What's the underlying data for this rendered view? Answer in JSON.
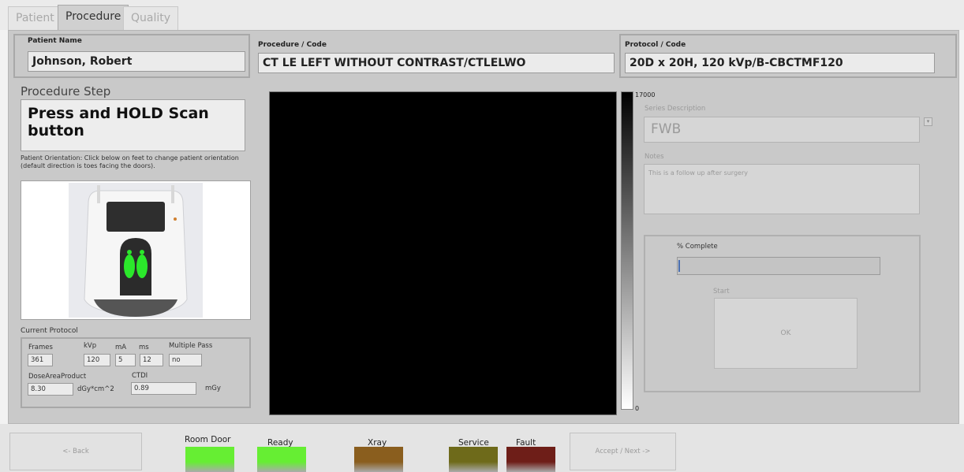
{
  "tabs": [
    "Patient",
    "Procedure",
    "Quality"
  ],
  "header": {
    "patient_name_label": "Patient Name",
    "patient_name": "Johnson, Robert",
    "procedure_label": "Procedure / Code",
    "procedure": "CT LE LEFT WITHOUT CONTRAST/CTLELWO",
    "protocol_label": "Protocol / Code",
    "protocol": "20D x 20H, 120 kVp/B-CBCTMF120"
  },
  "procedure_step": {
    "label": "Procedure Step",
    "value": "Press and HOLD Scan button"
  },
  "orientation_text": "Patient Orientation: Click below on feet to change patient orientation (default direction is toes facing the doors).",
  "current_protocol": {
    "label": "Current Protocol",
    "frames_label": "Frames",
    "frames": "361",
    "kvp_label": "kVp",
    "kvp": "120",
    "ma_label": "mA",
    "ma": "5",
    "ms_label": "ms",
    "ms": "12",
    "multiple_pass_label": "Multiple Pass",
    "multiple_pass": "no",
    "dap_label": "DoseAreaProduct",
    "dap": "8.30",
    "dap_unit": "dGy*cm^2",
    "ctdi_label": "CTDI",
    "ctdi": "0.89",
    "ctdi_unit": "mGy"
  },
  "viewer": {
    "scale_max": "17000",
    "scale_min": "0"
  },
  "series": {
    "label": "Series Description",
    "value": "FWB",
    "notes_label": "Notes",
    "notes": "This is a follow up after surgery"
  },
  "progress": {
    "label": "% Complete",
    "percent": 0
  },
  "start": {
    "label": "Start",
    "button": "OK"
  },
  "bottom": {
    "back": "<- Back",
    "accept": "Accept / Next ->",
    "indicators": [
      {
        "label": "Room Door",
        "color": "#66ee33"
      },
      {
        "label": "Ready",
        "color": "#66ee33"
      },
      {
        "label": "Xray",
        "color": "#8a5e1e"
      },
      {
        "label": "Service",
        "color": "#6e6a1a"
      },
      {
        "label": "Fault",
        "color": "#6e1e18"
      }
    ]
  },
  "colors": {
    "panel": "#c9c9c9",
    "lamp_on": "#66ee33"
  }
}
